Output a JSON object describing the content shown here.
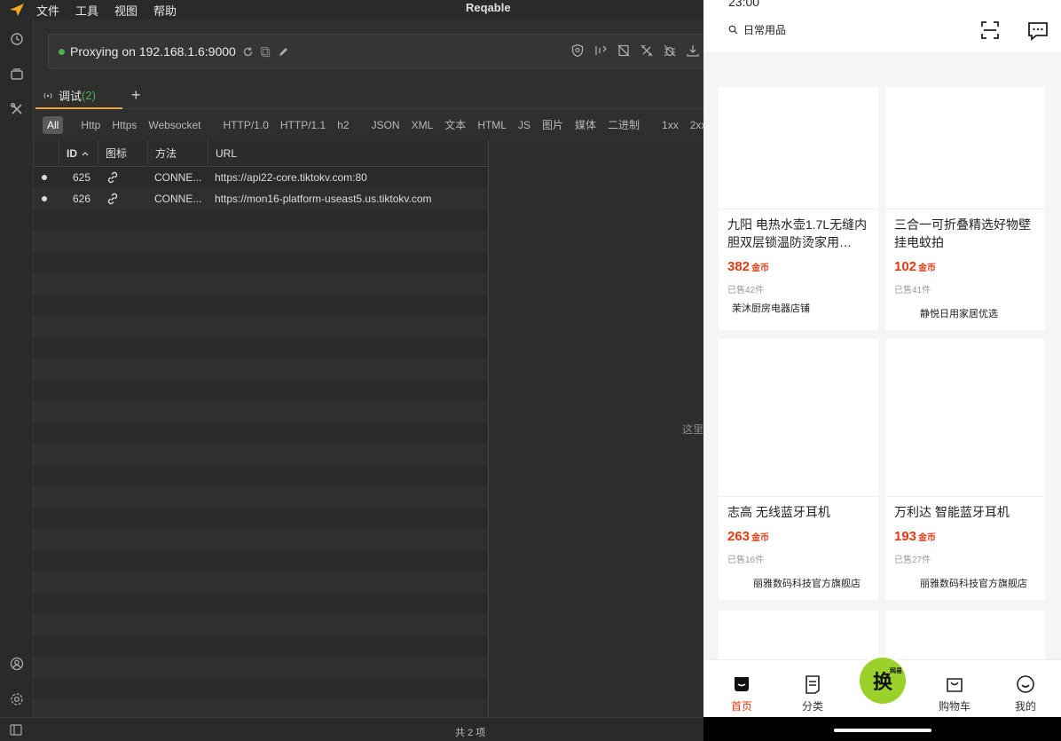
{
  "menu": {
    "items": [
      "文件",
      "工具",
      "视图",
      "帮助"
    ],
    "app_title": "Reqable"
  },
  "proxy": {
    "status_text": "Proxying on 192.168.1.6:9000"
  },
  "tabs": {
    "active_label": "调试",
    "active_count": "(2)",
    "add_label": "+"
  },
  "filters": [
    {
      "label": "All",
      "active": true
    },
    {
      "sep": true
    },
    {
      "label": "Http"
    },
    {
      "label": "Https"
    },
    {
      "label": "Websocket"
    },
    {
      "sep": true
    },
    {
      "label": "HTTP/1.0"
    },
    {
      "label": "HTTP/1.1"
    },
    {
      "label": "h2"
    },
    {
      "sep": true
    },
    {
      "label": "JSON"
    },
    {
      "label": "XML"
    },
    {
      "label": "文本"
    },
    {
      "label": "HTML"
    },
    {
      "label": "JS"
    },
    {
      "label": "图片"
    },
    {
      "label": "媒体"
    },
    {
      "label": "二进制"
    },
    {
      "sep": true
    },
    {
      "label": "1xx"
    },
    {
      "label": "2xx"
    }
  ],
  "table": {
    "headers": {
      "id": "ID",
      "icon": "图标",
      "method": "方法",
      "url": "URL"
    },
    "rows": [
      {
        "id": "625",
        "method": "CONNE...",
        "url": "https://api22-core.tiktokv.com:80"
      },
      {
        "id": "626",
        "method": "CONNE...",
        "url": "https://mon16-platform-useast5.us.tiktokv.com"
      }
    ]
  },
  "detail": {
    "hint": "这里"
  },
  "status": {
    "count": "共 2 项"
  },
  "phone": {
    "status_time": "23:00",
    "search_text": "日常用品",
    "products": [
      {
        "title": "九阳 电热水壶1.7L无缝内胆双层锁温防烫家用…",
        "price": "382",
        "unit": "金币",
        "sold": "已售42件",
        "shop": "茉沐厨房电器店铺"
      },
      {
        "title": "三合一可折叠精选好物壁挂电蚊拍",
        "price": "102",
        "unit": "金币",
        "sold": "已售41件",
        "shop": "静悦日用家居优选"
      },
      {
        "title": "志高 无线蓝牙耳机",
        "price": "263",
        "unit": "金币",
        "sold": "已售16件",
        "shop": "丽雅数码科技官方旗舰店"
      },
      {
        "title": "万利达 智能蓝牙耳机",
        "price": "193",
        "unit": "金币",
        "sold": "已售27件",
        "shop": "丽雅数码科技官方旗舰店"
      }
    ],
    "nav": [
      "首页",
      "分类",
      "换",
      "购物车",
      "我的"
    ],
    "center_badge": "网易"
  }
}
